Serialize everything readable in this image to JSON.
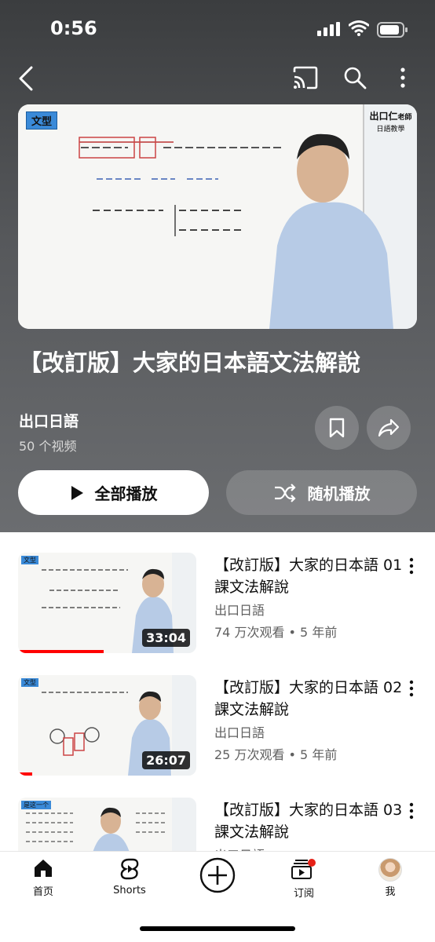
{
  "status_bar": {
    "time": "0:56"
  },
  "playlist": {
    "cover_badge": "文型",
    "cover_teacher_name": "出口仁",
    "cover_teacher_suffix": "老師",
    "cover_subtitle": "日語教學",
    "title": "【改訂版】大家的日本語文法解說",
    "channel": "出口日語",
    "video_count": "50 个视频",
    "play_all_label": "全部播放",
    "shuffle_label": "随机播放"
  },
  "videos": [
    {
      "title": "【改訂版】大家的日本語 01 課文法解說",
      "channel": "出口日語",
      "meta": "74 万次观看 • 5 年前",
      "duration": "33:04",
      "progress": 0.48,
      "badge": "文型"
    },
    {
      "title": "【改訂版】大家的日本語 02 課文法解說",
      "channel": "出口日語",
      "meta": "25 万次观看 • 5 年前",
      "duration": "26:07",
      "progress": 0.08,
      "badge": "文型"
    },
    {
      "title": "【改訂版】大家的日本語 03 課文法解說",
      "channel": "出口日語",
      "meta": "",
      "duration": "",
      "progress": 0,
      "badge": "是这一个"
    }
  ],
  "bottom_nav": {
    "home": "首页",
    "shorts": "Shorts",
    "subscriptions": "订阅",
    "you": "我"
  },
  "colors": {
    "accent_red": "#ff0000",
    "header_bg": "#4a4c4f"
  },
  "icons": [
    "back-icon",
    "cast-icon",
    "search-icon",
    "more-vertical-icon",
    "bookmark-icon",
    "share-icon",
    "play-icon",
    "shuffle-icon",
    "home-icon",
    "shorts-icon",
    "create-icon",
    "subscriptions-icon",
    "avatar"
  ]
}
